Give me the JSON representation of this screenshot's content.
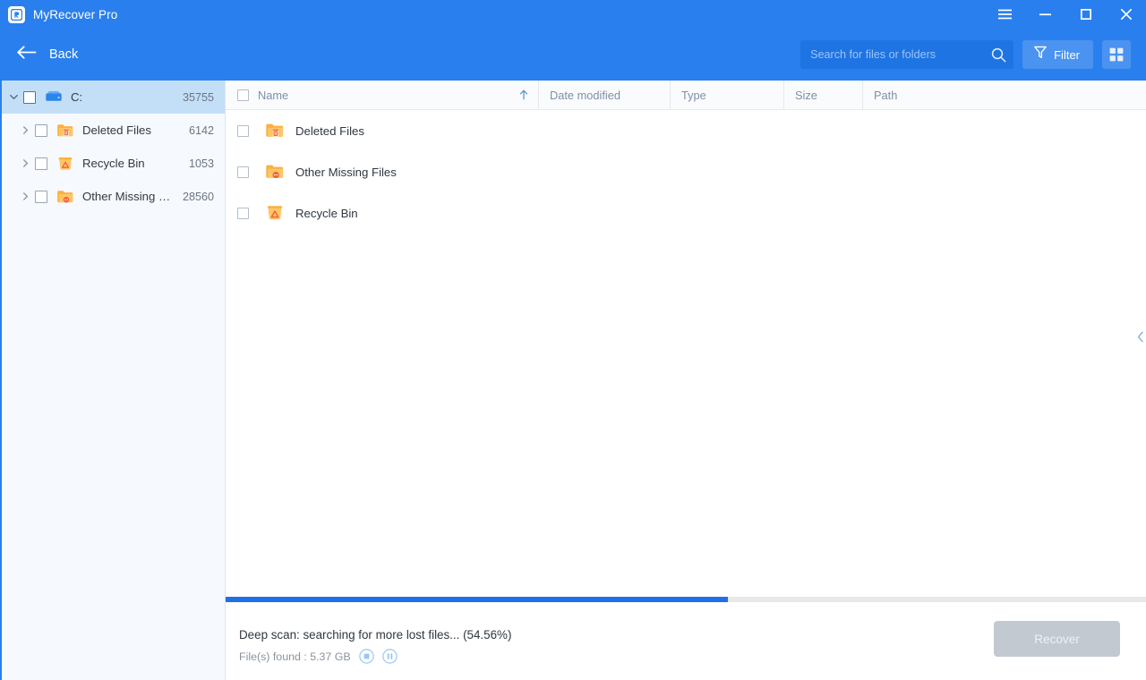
{
  "window": {
    "app_title": "MyRecover Pro",
    "logo_icon": "app-logo-icon",
    "controls": {
      "menu_label": "menu-icon",
      "minimize_label": "minimize-icon",
      "maximize_label": "maximize-icon",
      "close_label": "close-icon"
    }
  },
  "toolbar": {
    "back_label": "Back",
    "back_icon": "arrow-left-icon",
    "search": {
      "value": "",
      "placeholder": "Search for files or folders",
      "icon": "search-icon"
    },
    "filter_label": "Filter",
    "filter_icon": "funnel-icon",
    "grid_view_icon": "grid-view-icon"
  },
  "sidebar": {
    "items": [
      {
        "label": "C:",
        "count": "35755",
        "icon": "hard-drive-icon",
        "depth": 0,
        "expanded": true,
        "selected": true,
        "checked": false
      },
      {
        "label": "Deleted Files",
        "count": "6142",
        "icon": "folder-deleted-icon",
        "depth": 1,
        "expanded": false,
        "selected": false,
        "checked": false
      },
      {
        "label": "Recycle Bin",
        "count": "1053",
        "icon": "folder-recyclebin-icon",
        "depth": 1,
        "expanded": false,
        "selected": false,
        "checked": false
      },
      {
        "label": "Other Missing Files",
        "count": "28560",
        "icon": "folder-missing-icon",
        "depth": 1,
        "expanded": false,
        "selected": false,
        "checked": false
      }
    ]
  },
  "table": {
    "columns": {
      "name": "Name",
      "date_modified": "Date modified",
      "type": "Type",
      "size": "Size",
      "path": "Path"
    },
    "sort": {
      "column": "Name",
      "direction": "ascending",
      "icon": "arrow-up-icon"
    },
    "rows": [
      {
        "name": "Deleted Files",
        "date_modified": "",
        "type": "",
        "size": "",
        "path": "",
        "icon": "folder-deleted-icon",
        "checked": false
      },
      {
        "name": "Other Missing Files",
        "date_modified": "",
        "type": "",
        "size": "",
        "path": "",
        "icon": "folder-missing-icon",
        "checked": false
      },
      {
        "name": "Recycle Bin",
        "date_modified": "",
        "type": "",
        "size": "",
        "path": "",
        "icon": "folder-recyclebin-icon",
        "checked": false
      }
    ]
  },
  "panel": {
    "collapse_icon": "chevron-left-icon"
  },
  "footer": {
    "progress_percent": 54.56,
    "status_text": "Deep scan: searching for more lost files... (54.56%)",
    "files_found_text": "File(s) found : 5.37 GB",
    "stop_icon": "stop-icon",
    "pause_icon": "pause-icon",
    "recover_label": "Recover",
    "recover_enabled": false
  },
  "colors": {
    "brand_blue": "#2a7fee",
    "search_bg": "#1f74e3",
    "button_blue": "#4a93f0",
    "selected_row": "#c3dff7",
    "sidebar_bg": "#f6f9fd",
    "progress_fill": "#1f70e8",
    "progress_track": "#e6e8ea",
    "recover_disabled": "#c2c9d0",
    "folder_orange": "#fbb040"
  }
}
